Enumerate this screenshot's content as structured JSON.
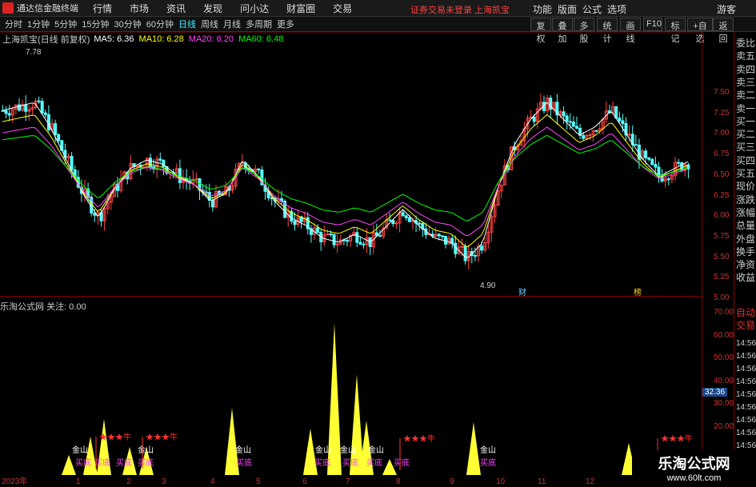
{
  "menubar": {
    "appname": "通达信金融终端",
    "items": [
      "行情",
      "市场",
      "资讯",
      "发现",
      "问小达",
      "财富圈",
      "交易"
    ],
    "notice": "证券交易未登录  上海凯宝",
    "right": [
      "功能",
      "版面",
      "公式",
      "选项",
      "游客"
    ]
  },
  "toolbar": {
    "periods": [
      "分时",
      "1分钟",
      "5分钟",
      "15分钟",
      "30分钟",
      "60分钟",
      "日线",
      "周线",
      "月线",
      "多周期",
      "更多"
    ],
    "active": "日线",
    "buttons": [
      "复权",
      "叠加",
      "多股",
      "统计",
      "画线",
      "F10",
      "标记",
      "+自选",
      "返回"
    ]
  },
  "info": {
    "stock": "上海凯宝(日线 前复权)",
    "ma": [
      {
        "label": "MA5: 6.36",
        "color": "#ffffff"
      },
      {
        "label": "MA10: 6.28",
        "color": "#ffff00"
      },
      {
        "label": "MA20: 6.20",
        "color": "#ff44ff"
      },
      {
        "label": "MA60: 6.48",
        "color": "#00ff00"
      }
    ],
    "high": "7.78",
    "low": "4.90"
  },
  "price_axis": [
    "7.50",
    "7.25",
    "7.00",
    "6.75",
    "6.50",
    "6.25",
    "6.00",
    "5.75",
    "5.50",
    "5.25",
    "5.00"
  ],
  "indicator": {
    "name": "乐淘公式网",
    "value": "关注: 0.00",
    "axis": [
      "70.00",
      "60.00",
      "50.00",
      "40.00",
      "30.00",
      "20.00"
    ],
    "current": "32.36",
    "labels": [
      "金山",
      "买底",
      "★★★牛"
    ],
    "markers": [
      "财",
      "榜"
    ],
    "month_labels": [
      "2023年",
      "1",
      "2",
      "3",
      "4",
      "5",
      "6",
      "7",
      "8",
      "9",
      "10",
      "11",
      "12"
    ]
  },
  "sidebar": [
    "委比",
    "卖五",
    "卖四",
    "卖三",
    "卖二",
    "卖一",
    "买一",
    "买二",
    "买三",
    "买四",
    "买五",
    "现价",
    "涨跌",
    "涨幅",
    "总量",
    "外盘",
    "换手",
    "净资",
    "收益",
    "自动",
    "交易"
  ],
  "times": [
    "14:56",
    "14:56",
    "14:56",
    "14:56",
    "14:56",
    "14:56",
    "14:56",
    "14:56",
    "14:56"
  ],
  "watermark": {
    "title": "乐淘公式网",
    "url": "www.60lt.com"
  }
}
